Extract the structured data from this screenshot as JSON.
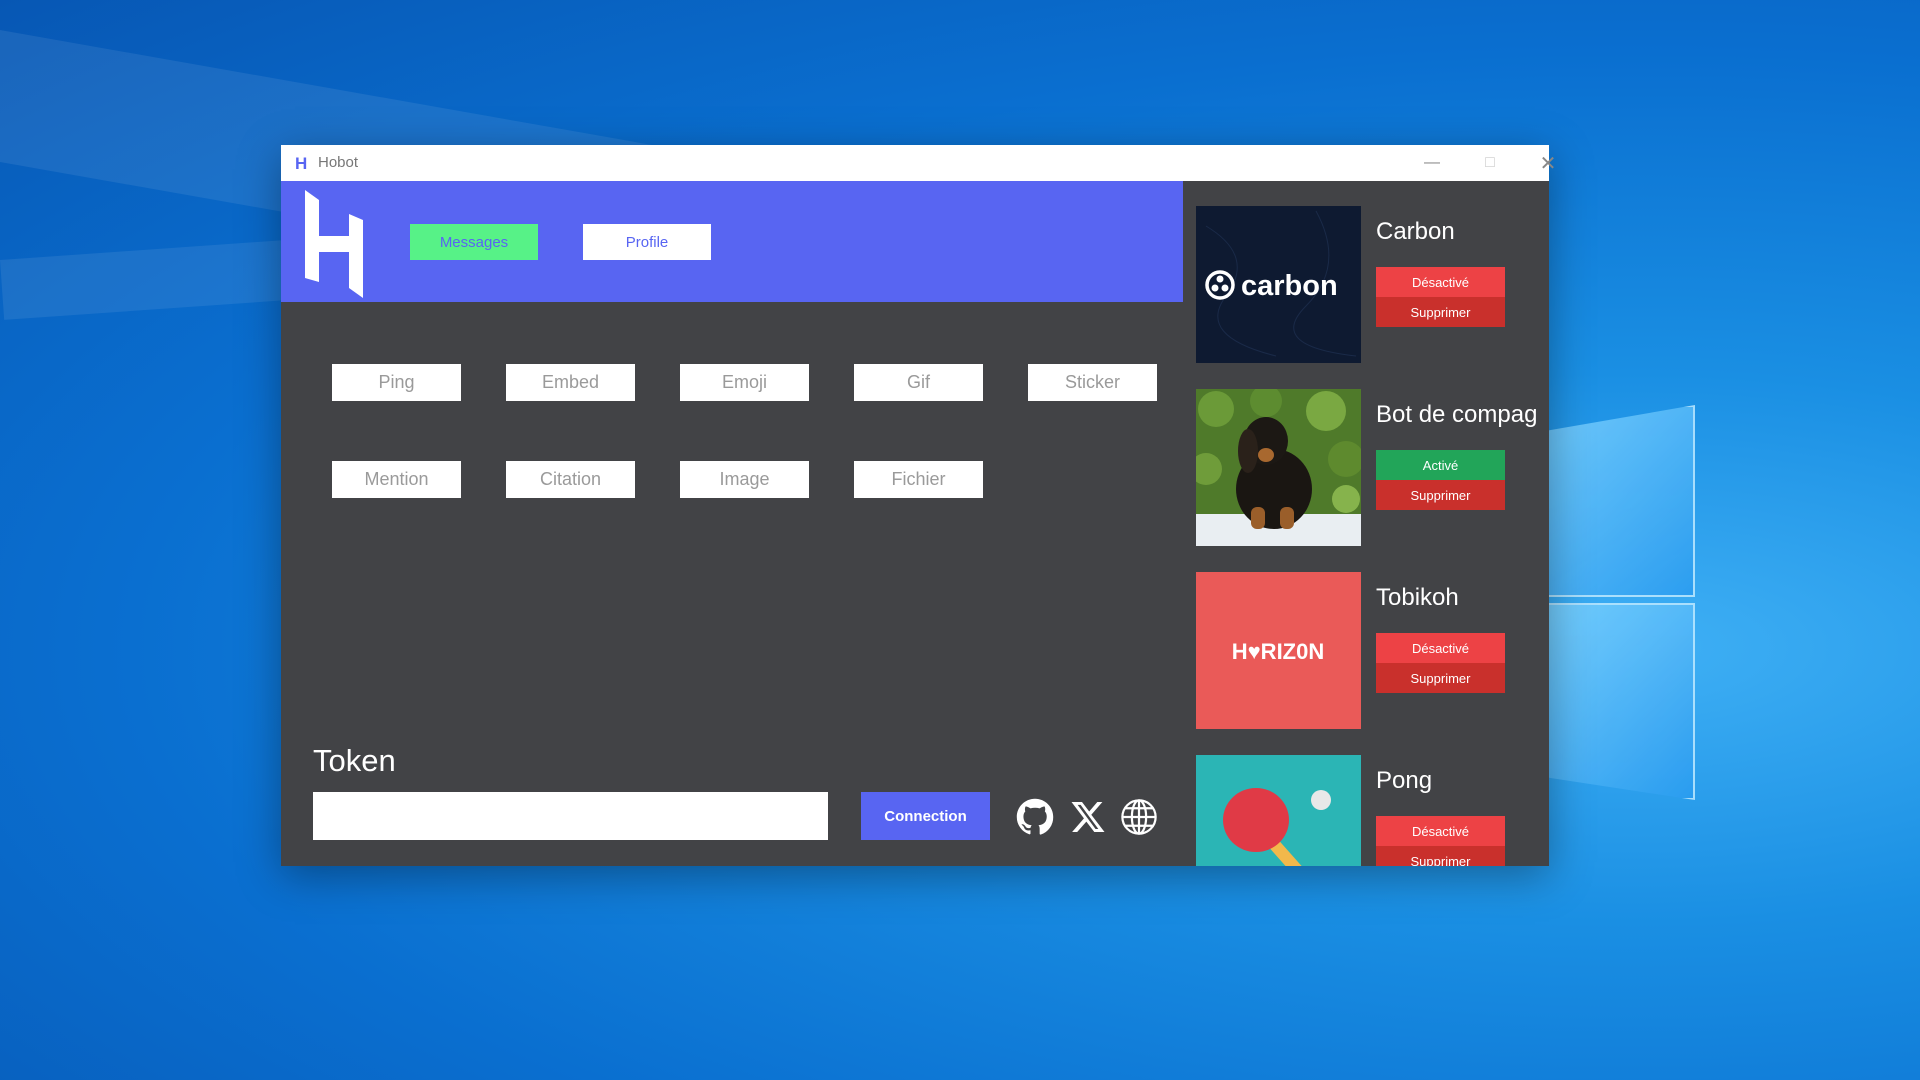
{
  "window": {
    "title": "Hobot",
    "app_icon": "H"
  },
  "titlebar": {
    "minimize": "minimize-icon",
    "maximize": "maximize-icon",
    "close": "close-icon"
  },
  "header": {
    "messages_label": "Messages",
    "profile_label": "Profile"
  },
  "message_buttons": [
    "Ping",
    "Embed",
    "Emoji",
    "Gif",
    "Sticker",
    "Mention",
    "Citation",
    "Image",
    "Fichier"
  ],
  "token": {
    "label": "Token",
    "value": "",
    "connect_label": "Connection"
  },
  "socials": [
    "github-icon",
    "x-icon",
    "globe-icon"
  ],
  "bots": [
    {
      "name": "Carbon",
      "status": "Désactivé",
      "active": false,
      "delete_label": "Supprimer",
      "thumb_text": "carbon"
    },
    {
      "name": "Bot de compag",
      "status": "Activé",
      "active": true,
      "delete_label": "Supprimer"
    },
    {
      "name": "Tobikoh",
      "status": "Désactivé",
      "active": false,
      "delete_label": "Supprimer",
      "thumb_text": "H♥RIZ0N"
    },
    {
      "name": "Pong",
      "status": "Désactivé",
      "active": false,
      "delete_label": "Supprimer"
    }
  ],
  "colors": {
    "blurple": "#5865f2",
    "green": "#57f287",
    "active_green": "#22a559",
    "red": "#ed4245",
    "dark_bg": "#424346"
  }
}
